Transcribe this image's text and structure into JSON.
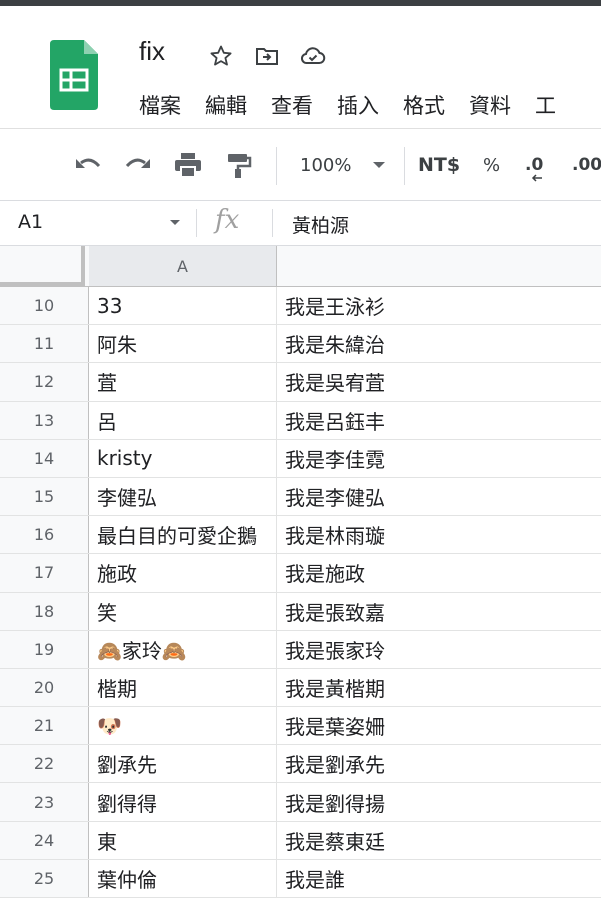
{
  "doc": {
    "title": "fix",
    "icons": [
      "star-icon",
      "move-to-folder-icon",
      "cloud-saved-icon"
    ]
  },
  "menu": [
    "檔案",
    "編輯",
    "查看",
    "插入",
    "格式",
    "資料",
    "工"
  ],
  "toolbar": {
    "zoom": "100%",
    "currency": "NT$",
    "percent": "%",
    "decrease_decimal": ".0",
    "increase_decimal": ".00"
  },
  "formula_bar": {
    "cell_ref": "A1",
    "fx": "fx",
    "value": "黃柏源"
  },
  "columns": [
    "A",
    ""
  ],
  "rows": [
    {
      "num": "10",
      "a": "33",
      "b": "我是王泳衫"
    },
    {
      "num": "11",
      "a": "阿朱",
      "b": "我是朱緯治"
    },
    {
      "num": "12",
      "a": "萓",
      "b": "我是吳宥萓"
    },
    {
      "num": "13",
      "a": "呂",
      "b": "我是呂鈺丰"
    },
    {
      "num": "14",
      "a": "kristy",
      "b": "我是李佳霓"
    },
    {
      "num": "15",
      "a": "李健弘",
      "b": "我是李健弘"
    },
    {
      "num": "16",
      "a": "最白目的可愛企鵝",
      "b": "我是林雨璇"
    },
    {
      "num": "17",
      "a": "施政",
      "b": "我是施政"
    },
    {
      "num": "18",
      "a": "笑",
      "b": "我是張致嘉"
    },
    {
      "num": "19",
      "a": "🙈家玲🙈",
      "b": "我是張家玲"
    },
    {
      "num": "20",
      "a": "楷期",
      "b": "我是黃楷期"
    },
    {
      "num": "21",
      "a": "🐶",
      "b": "我是葉姿姍"
    },
    {
      "num": "22",
      "a": "劉承先",
      "b": "我是劉承先"
    },
    {
      "num": "23",
      "a": "劉得得",
      "b": "我是劉得揚"
    },
    {
      "num": "24",
      "a": "東",
      "b": "我是蔡東廷"
    },
    {
      "num": "25",
      "a": "葉仲倫",
      "b": "我是誰"
    }
  ]
}
